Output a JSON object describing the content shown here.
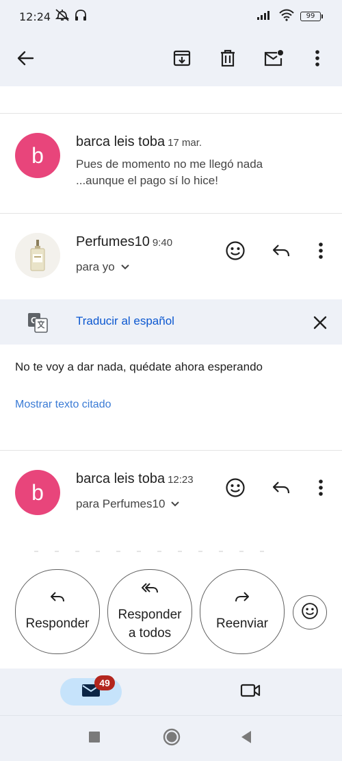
{
  "status_bar": {
    "time": "12:24",
    "battery": "99"
  },
  "toolbar": {
    "back_icon": "arrow-left-icon",
    "archive_icon": "archive-icon",
    "delete_icon": "trash-icon",
    "mark_unread_icon": "mark-unread-icon",
    "more_icon": "more-vert-icon"
  },
  "messages": [
    {
      "sender": "barca leis toba",
      "date": "17 mar.",
      "avatar_letter": "b",
      "snippet": "Pues de momento no me llegó nada ...aunque el pago sí lo hice!"
    },
    {
      "sender": "Perfumes10",
      "date": "9:40",
      "to_line": "para yo"
    },
    {
      "sender": "barca leis toba",
      "date": "12:23",
      "avatar_letter": "b",
      "to_line": "para Perfumes10"
    }
  ],
  "translate": {
    "label": "Traducir al español"
  },
  "email_body": {
    "text": "No te voy a dar nada, quédate ahora esperando",
    "quoted_link": "Mostrar texto citado"
  },
  "reply_actions": {
    "reply": "Responder",
    "reply_all_line1": "Responder",
    "reply_all_line2": "a todos",
    "forward": "Reenviar"
  },
  "bottom_nav": {
    "mail_badge": "49"
  },
  "colors": {
    "accent": "#0b57d0",
    "avatar": "#e8457b",
    "badge": "#b3261e",
    "bar_bg": "#eef1f7"
  }
}
